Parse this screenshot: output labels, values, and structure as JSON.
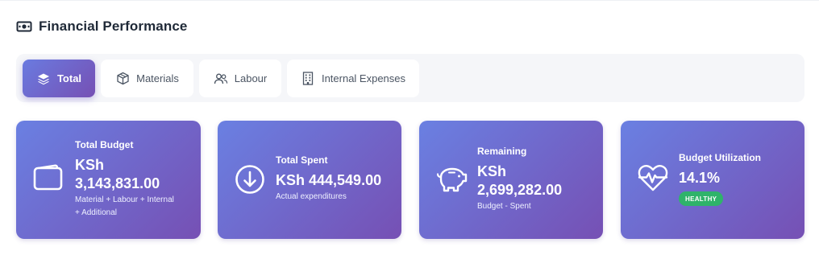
{
  "header": {
    "title": "Financial Performance",
    "icon": "money-bill-icon"
  },
  "tabs": [
    {
      "label": "Total",
      "icon": "layers-icon",
      "active": true
    },
    {
      "label": "Materials",
      "icon": "box-icon",
      "active": false
    },
    {
      "label": "Labour",
      "icon": "users-icon",
      "active": false
    },
    {
      "label": "Internal Expenses",
      "icon": "building-icon",
      "active": false
    }
  ],
  "cards": {
    "total_budget": {
      "label": "Total Budget",
      "value_line1": "KSh",
      "value_line2": "3,143,831.00",
      "note_line1": "Material + Labour + Internal",
      "note_line2": "+ Additional",
      "icon": "wallet-icon"
    },
    "total_spent": {
      "label": "Total Spent",
      "value": "KSh 444,549.00",
      "note": "Actual expenditures",
      "icon": "arrow-down-circle-icon"
    },
    "remaining": {
      "label": "Remaining",
      "value_line1": "KSh",
      "value_line2": "2,699,282.00",
      "note": "Budget - Spent",
      "icon": "piggy-bank-icon"
    },
    "utilization": {
      "label": "Budget Utilization",
      "value": "14.1%",
      "badge": "HEALTHY",
      "icon": "heart-pulse-icon"
    }
  },
  "colors": {
    "card_gradient_start": "#6a80e2",
    "card_gradient_end": "#7650b4",
    "badge_healthy": "#2fb36a",
    "tabbar_bg": "#f5f6f9"
  }
}
